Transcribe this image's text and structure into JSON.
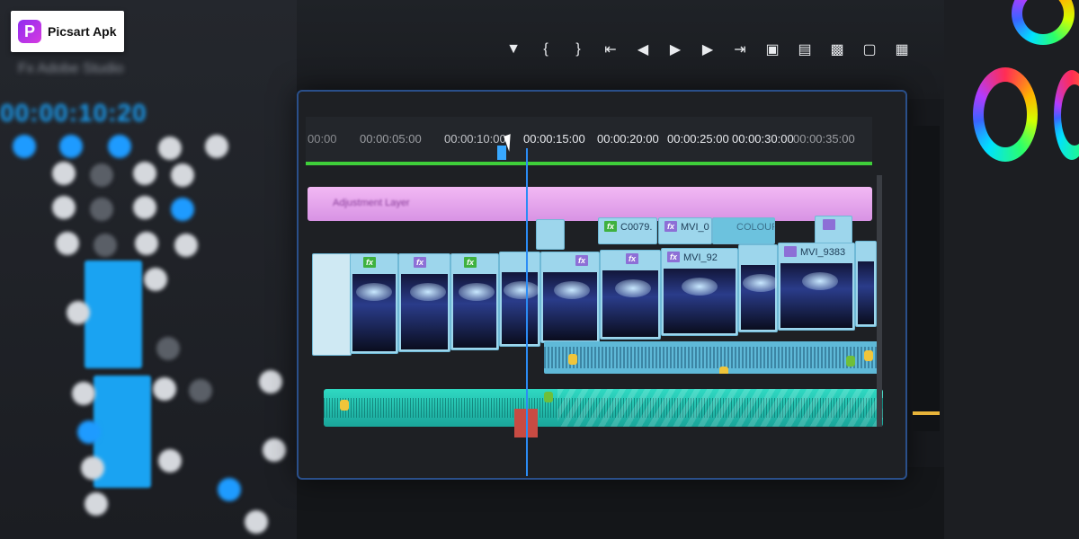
{
  "brand": {
    "name": "Picsart Apk",
    "logo_letter": "P"
  },
  "left_panel": {
    "timecode": "00:00:10:20",
    "title": "Fx Adobe Studio"
  },
  "transport": {
    "buttons": [
      "marker",
      "in",
      "out",
      "go-to-in",
      "step-back",
      "play",
      "step-forward",
      "go-to-out",
      "insert",
      "overwrite",
      "lift",
      "export-frame",
      "compare"
    ]
  },
  "timeline": {
    "ruler_labels": [
      "00:00",
      "00:00:05:00",
      "00:00:10:00",
      "00:00:15:00",
      "00:00:20:00",
      "00:00:25:00",
      "00:00:30:00",
      "00:00:35:00"
    ],
    "adjustment_layer": "Adjustment Layer",
    "clips_top": [
      "C0079.",
      "MVI_0",
      "COLOUR BAR"
    ],
    "clips_main": [
      "MVI_92",
      "MVI_9383"
    ],
    "colors": {
      "playhead": "#2b8cf5",
      "audio": "#2fd9c2",
      "adjustment": "#e3a5ea",
      "clip": "#9dd6ec"
    }
  }
}
